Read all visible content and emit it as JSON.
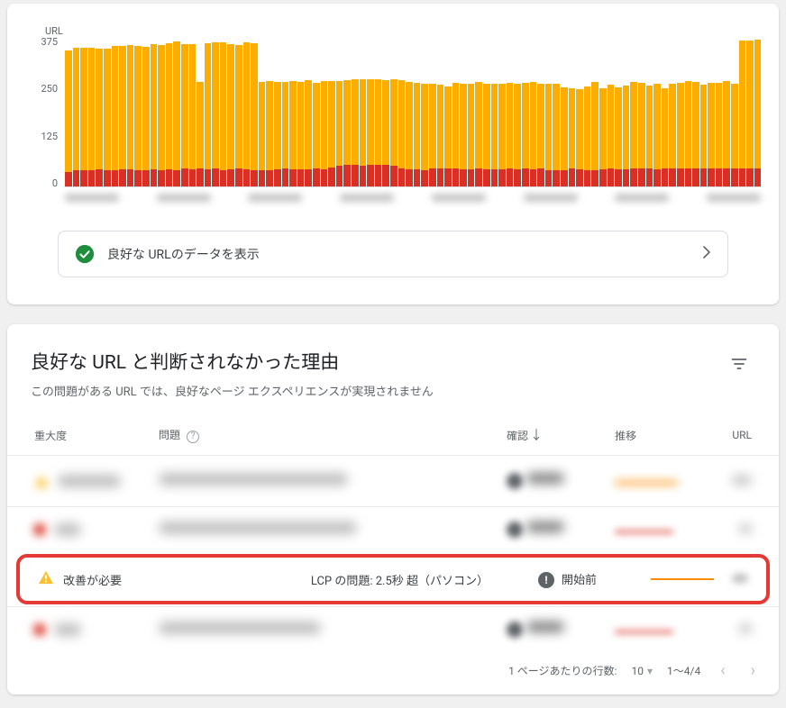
{
  "chart_data": {
    "type": "bar",
    "title": "",
    "xlabel": "",
    "ylabel": "URL",
    "ylim": [
      0,
      375
    ],
    "yticks": [
      375,
      250,
      125,
      0
    ],
    "categories_blurred": 8,
    "series": [
      {
        "name": "needs-improvement",
        "color": "#fbae00"
      },
      {
        "name": "poor",
        "color": "#d93025"
      }
    ],
    "bars": [
      {
        "t": 340,
        "b": 35
      },
      {
        "t": 345,
        "b": 40
      },
      {
        "t": 345,
        "b": 40
      },
      {
        "t": 345,
        "b": 40
      },
      {
        "t": 343,
        "b": 42
      },
      {
        "t": 343,
        "b": 40
      },
      {
        "t": 351,
        "b": 40
      },
      {
        "t": 350,
        "b": 42
      },
      {
        "t": 353,
        "b": 43
      },
      {
        "t": 350,
        "b": 41
      },
      {
        "t": 348,
        "b": 41
      },
      {
        "t": 355,
        "b": 42
      },
      {
        "t": 353,
        "b": 41
      },
      {
        "t": 358,
        "b": 43
      },
      {
        "t": 362,
        "b": 41
      },
      {
        "t": 355,
        "b": 45
      },
      {
        "t": 355,
        "b": 43
      },
      {
        "t": 261,
        "b": 45
      },
      {
        "t": 358,
        "b": 43
      },
      {
        "t": 360,
        "b": 45
      },
      {
        "t": 360,
        "b": 41
      },
      {
        "t": 355,
        "b": 42
      },
      {
        "t": 353,
        "b": 44
      },
      {
        "t": 360,
        "b": 42
      },
      {
        "t": 358,
        "b": 41
      },
      {
        "t": 260,
        "b": 40
      },
      {
        "t": 262,
        "b": 41
      },
      {
        "t": 261,
        "b": 42
      },
      {
        "t": 261,
        "b": 44
      },
      {
        "t": 262,
        "b": 42
      },
      {
        "t": 261,
        "b": 42
      },
      {
        "t": 265,
        "b": 43
      },
      {
        "t": 258,
        "b": 44
      },
      {
        "t": 263,
        "b": 43
      },
      {
        "t": 262,
        "b": 47
      },
      {
        "t": 263,
        "b": 52
      },
      {
        "t": 265,
        "b": 55
      },
      {
        "t": 267,
        "b": 53
      },
      {
        "t": 267,
        "b": 52
      },
      {
        "t": 268,
        "b": 53
      },
      {
        "t": 267,
        "b": 54
      },
      {
        "t": 264,
        "b": 53
      },
      {
        "t": 268,
        "b": 52
      },
      {
        "t": 266,
        "b": 45
      },
      {
        "t": 260,
        "b": 42
      },
      {
        "t": 258,
        "b": 42
      },
      {
        "t": 256,
        "b": 41
      },
      {
        "t": 255,
        "b": 44
      },
      {
        "t": 253,
        "b": 45
      },
      {
        "t": 250,
        "b": 46
      },
      {
        "t": 258,
        "b": 45
      },
      {
        "t": 256,
        "b": 42
      },
      {
        "t": 256,
        "b": 43
      },
      {
        "t": 260,
        "b": 44
      },
      {
        "t": 256,
        "b": 42
      },
      {
        "t": 255,
        "b": 42
      },
      {
        "t": 257,
        "b": 42
      },
      {
        "t": 258,
        "b": 44
      },
      {
        "t": 256,
        "b": 43
      },
      {
        "t": 258,
        "b": 44
      },
      {
        "t": 260,
        "b": 42
      },
      {
        "t": 256,
        "b": 44
      },
      {
        "t": 256,
        "b": 41
      },
      {
        "t": 256,
        "b": 40
      },
      {
        "t": 247,
        "b": 41
      },
      {
        "t": 245,
        "b": 44
      },
      {
        "t": 242,
        "b": 42
      },
      {
        "t": 250,
        "b": 41
      },
      {
        "t": 260,
        "b": 40
      },
      {
        "t": 245,
        "b": 43
      },
      {
        "t": 253,
        "b": 44
      },
      {
        "t": 248,
        "b": 43
      },
      {
        "t": 252,
        "b": 42
      },
      {
        "t": 261,
        "b": 44
      },
      {
        "t": 258,
        "b": 45
      },
      {
        "t": 251,
        "b": 44
      },
      {
        "t": 257,
        "b": 42
      },
      {
        "t": 244,
        "b": 44
      },
      {
        "t": 256,
        "b": 45
      },
      {
        "t": 259,
        "b": 45
      },
      {
        "t": 262,
        "b": 45
      },
      {
        "t": 261,
        "b": 44
      },
      {
        "t": 254,
        "b": 45
      },
      {
        "t": 258,
        "b": 45
      },
      {
        "t": 258,
        "b": 44
      },
      {
        "t": 263,
        "b": 44
      },
      {
        "t": 256,
        "b": 45
      },
      {
        "t": 364,
        "b": 45
      },
      {
        "t": 363,
        "b": 45
      },
      {
        "t": 365,
        "b": 46
      }
    ]
  },
  "good_row": {
    "text": "良好な URLのデータを表示"
  },
  "issues": {
    "title": "良好な URL と判断されなかった理由",
    "subtitle": "この問題がある URL では、良好なページ エクスペリエンスが実現されません",
    "columns": {
      "severity": "重大度",
      "issue": "問題",
      "check": "確認",
      "trend": "推移",
      "url": "URL"
    },
    "highlighted": {
      "severity": "改善が必要",
      "issue": "LCP の問題: 2.5秒 超（パソコン）",
      "status_label": "開始前"
    }
  },
  "pager": {
    "rows_label": "1 ページあたりの行数:",
    "rows_value": "10",
    "range": "1～4/4"
  }
}
